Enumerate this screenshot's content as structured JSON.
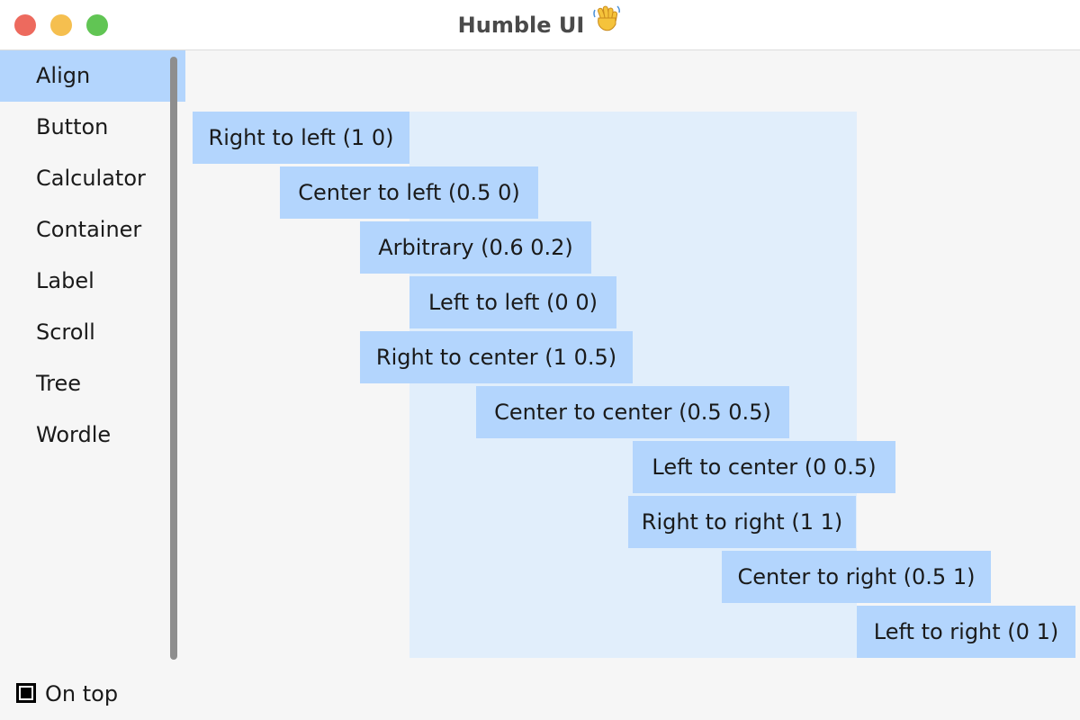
{
  "window": {
    "title": "Humble UI",
    "title_emoji": "👋",
    "traffic_lights": {
      "close_color": "#ed6a5e",
      "minimize_color": "#f5bf4f",
      "zoom_color": "#61c554"
    }
  },
  "sidebar": {
    "selected_color": "#b3d5fd",
    "items": [
      {
        "label": "Align",
        "selected": true
      },
      {
        "label": "Button",
        "selected": false
      },
      {
        "label": "Calculator",
        "selected": false
      },
      {
        "label": "Container",
        "selected": false
      },
      {
        "label": "Label",
        "selected": false
      },
      {
        "label": "Scroll",
        "selected": false
      },
      {
        "label": "Tree",
        "selected": false
      },
      {
        "label": "Wordle",
        "selected": false
      }
    ]
  },
  "footer": {
    "on_top_label": "On top",
    "on_top_checked": true
  },
  "main": {
    "area_color": "#e1eefb",
    "label_color": "#b3d5fd",
    "labels": [
      "Right to left (1 0)",
      "Center to left (0.5 0)",
      "Arbitrary (0.6 0.2)",
      "Left to left (0 0)",
      "Right to center (1 0.5)",
      "Center to center (0.5 0.5)",
      "Left to center (0 0.5)",
      "Right to right (1 1)",
      "Center to right (0.5 1)",
      "Left to right (0 1)"
    ]
  }
}
